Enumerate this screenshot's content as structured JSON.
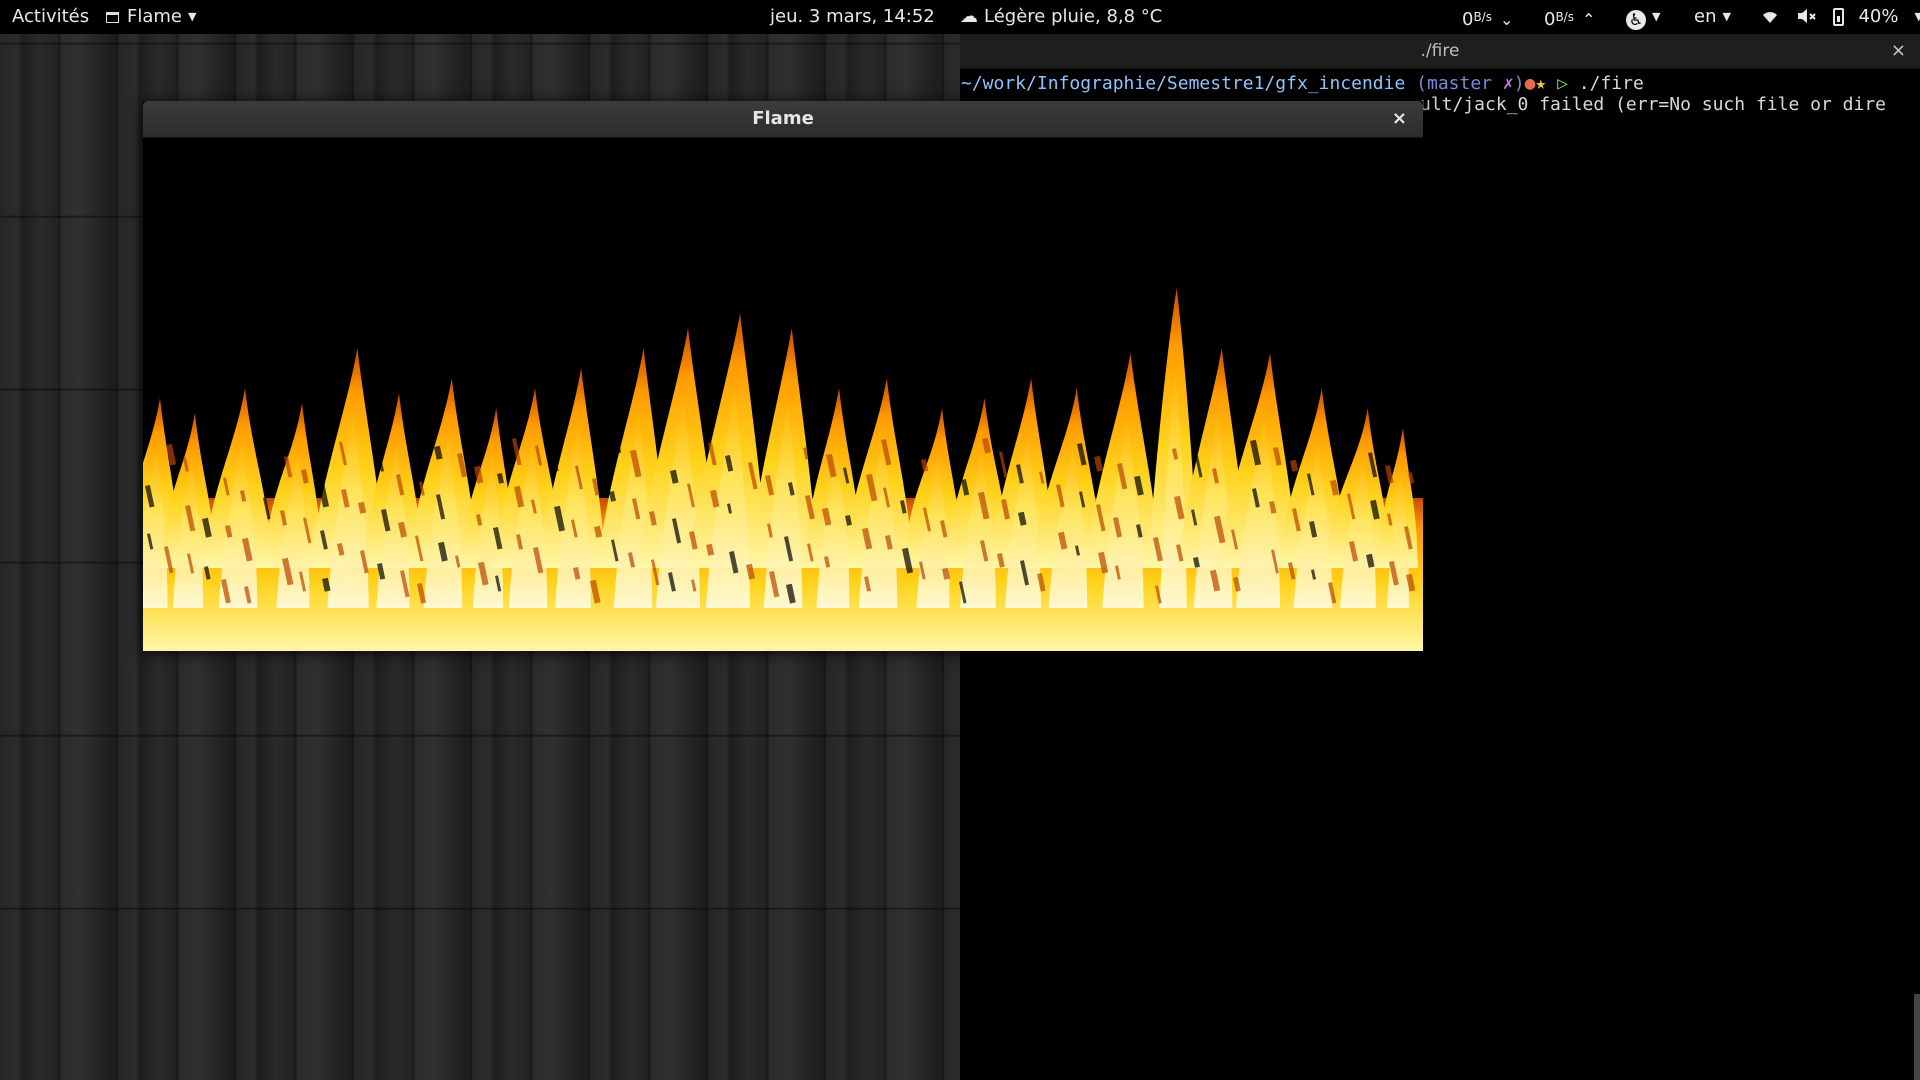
{
  "topbar": {
    "activities": "Activités",
    "app_menu": "Flame",
    "clock": "jeu.  3 mars, 14:52",
    "weather": "Légère pluie, 8,8 °C",
    "net_down_value": "0",
    "net_down_unit": "B/s",
    "net_up_value": "0",
    "net_up_unit": "B/s",
    "language": "en",
    "battery_percent": "40%",
    "icons": [
      "app-window-icon",
      "weather-rain-icon",
      "chevron-down-icon",
      "chevron-up-icon",
      "accessibility-icon",
      "wifi-icon",
      "volume-muted-icon",
      "battery-icon"
    ]
  },
  "terminal": {
    "title": "./fire",
    "close": "×",
    "prompt_path": "~/work/Infographie/Semestre1/gfx_incendie",
    "prompt_branch_open": " (master ",
    "prompt_dirty": "✗",
    "prompt_branch_close": ")",
    "prompt_dot": "●",
    "prompt_star": "★",
    "prompt_arrow": " ▷ ",
    "command": "./fire",
    "output_line": "ult/jack_0 failed (err=No such file or dire"
  },
  "flame_window": {
    "title": "Flame",
    "close": "×"
  },
  "colors": {
    "flame_core": "#fff6a8",
    "flame_mid": "#ffd21a",
    "flame_outer": "#ff9a00",
    "flame_edge": "#c84a00"
  }
}
